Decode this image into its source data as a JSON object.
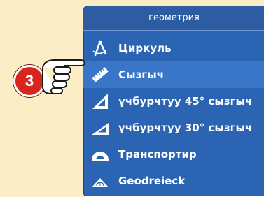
{
  "panel": {
    "title": "геометрия",
    "items": [
      {
        "label": "Циркуль",
        "icon": "compass-icon"
      },
      {
        "label": "Сызгыч",
        "icon": "ruler-icon"
      },
      {
        "label": "үчбурчтуу 45° сызгыч",
        "icon": "triangle-45-icon"
      },
      {
        "label": "үчбурчтуу 30° сызгыч",
        "icon": "triangle-30-icon"
      },
      {
        "label": "Транспортир",
        "icon": "protractor-icon"
      },
      {
        "label": "Geodreieck",
        "icon": "geodreieck-icon"
      }
    ]
  },
  "step_badge": "3",
  "colors": {
    "background": "#fbeec6",
    "panel": "#2b64b3",
    "header": "#2d5ca2",
    "badge": "#d8261d"
  }
}
